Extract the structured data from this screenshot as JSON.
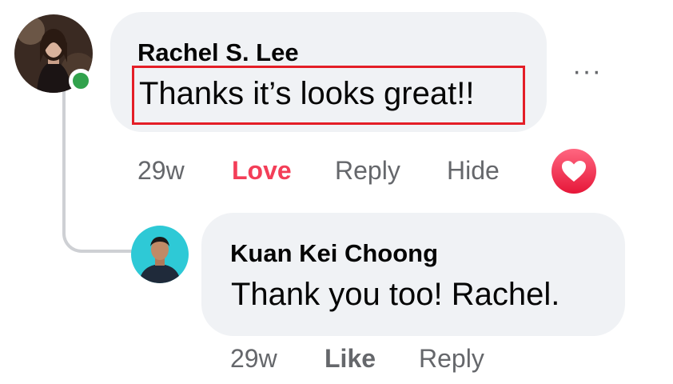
{
  "comment": {
    "author": "Rachel S. Lee",
    "text": "Thanks it’s looks great!!",
    "time": "29w",
    "love_label": "Love",
    "reply_label": "Reply",
    "hide_label": "Hide",
    "more_label": "···",
    "reaction_icon": "heart-icon",
    "reaction_color": "#f33e58",
    "online": true
  },
  "reply": {
    "author": "Kuan Kei Choong",
    "text": "Thank you too! Rachel.",
    "time": "29w",
    "like_label": "Like",
    "reply_label": "Reply"
  },
  "colors": {
    "bubble": "#f0f2f5",
    "meta": "#65676b",
    "highlight_border": "#e41e27",
    "online": "#31a24c"
  }
}
